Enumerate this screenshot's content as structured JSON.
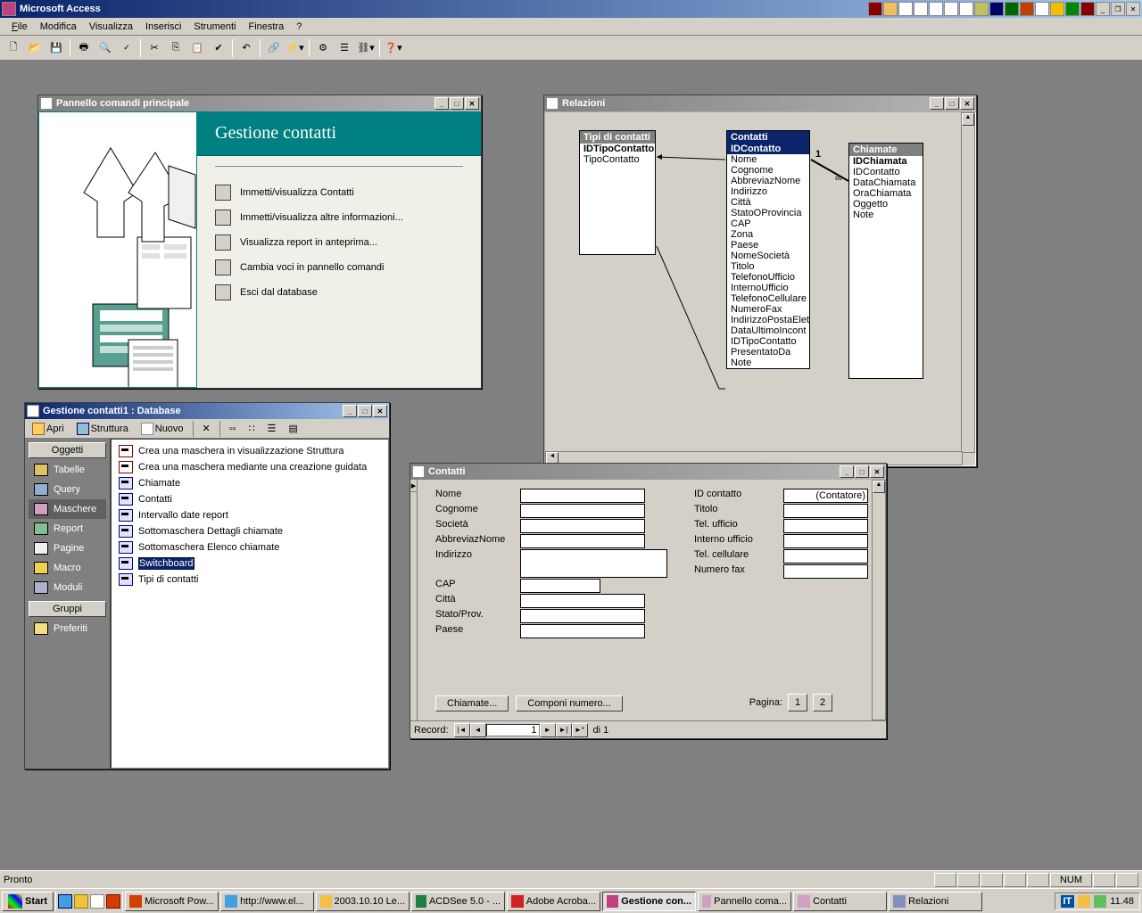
{
  "app": {
    "title": "Microsoft Access"
  },
  "menu": {
    "file": "File",
    "modifica": "Modifica",
    "visualizza": "Visualizza",
    "inserisci": "Inserisci",
    "strumenti": "Strumenti",
    "finestra": "Finestra",
    "help": "?"
  },
  "switchboard": {
    "title": "Pannello comandi principale",
    "heading": "Gestione contatti",
    "items": [
      "Immetti/visualizza Contatti",
      "Immetti/visualizza altre informazioni...",
      "Visualizza report in anteprima...",
      "Cambia voci in pannello comandi",
      "Esci dal database"
    ]
  },
  "dbwin": {
    "title": "Gestione contatti1 : Database",
    "toolbar": {
      "apri": "Apri",
      "struttura": "Struttura",
      "nuovo": "Nuovo"
    },
    "sidebar": {
      "header": "Oggetti",
      "tabelle": "Tabelle",
      "query": "Query",
      "maschere": "Maschere",
      "report": "Report",
      "pagine": "Pagine",
      "macro": "Macro",
      "moduli": "Moduli",
      "gruppi": "Gruppi",
      "preferiti": "Preferiti"
    },
    "list": [
      "Crea una maschera in visualizzazione Struttura",
      "Crea una maschera mediante una creazione guidata",
      "Chiamate",
      "Contatti",
      "Intervallo date report",
      "Sottomaschera Dettagli chiamate",
      "Sottomaschera Elenco chiamate",
      "Switchboard",
      "Tipi di contatti"
    ]
  },
  "relazioni": {
    "title": "Relazioni",
    "t1": {
      "name": "Tipi di contatti",
      "fields": [
        "IDTipoContatto",
        "TipoContatto"
      ]
    },
    "t2": {
      "name": "Contatti",
      "fields": [
        "IDContatto",
        "Nome",
        "Cognome",
        "AbbreviazNome",
        "Indirizzo",
        "Città",
        "StatoOProvincia",
        "CAP",
        "Zona",
        "Paese",
        "NomeSocietà",
        "Titolo",
        "TelefonoUfficio",
        "InternoUfficio",
        "TelefonoCellulare",
        "NumeroFax",
        "IndirizzoPostaElet",
        "DataUltimoIncont",
        "IDTipoContatto",
        "PresentatoDa",
        "Note"
      ]
    },
    "t3": {
      "name": "Chiamate",
      "fields": [
        "IDChiamata",
        "IDContatto",
        "DataChiamata",
        "OraChiamata",
        "Oggetto",
        "Note"
      ]
    },
    "rel_1": "1",
    "rel_inf": "∞"
  },
  "contatti": {
    "title": "Contatti",
    "labels": {
      "nome": "Nome",
      "cognome": "Cognome",
      "societa": "Società",
      "abbrev": "AbbreviazNome",
      "indirizzo": "Indirizzo",
      "cap": "CAP",
      "citta": "Città",
      "stato": "Stato/Prov.",
      "paese": "Paese",
      "idcontatto": "ID contatto",
      "titolo": "Titolo",
      "telufficio": "Tel. ufficio",
      "interno": "Interno ufficio",
      "telcell": "Tel. cellulare",
      "numfax": "Numero fax"
    },
    "idvalue": "(Contatore)",
    "buttons": {
      "chiamate": "Chiamate...",
      "componi": "Componi numero..."
    },
    "pagina": "Pagina:",
    "p1": "1",
    "p2": "2",
    "record": "Record:",
    "recval": "1",
    "reccount": "di 1"
  },
  "status": {
    "ready": "Pronto",
    "num": "NUM"
  },
  "taskbar": {
    "start": "Start",
    "tasks": [
      "Microsoft Pow...",
      "http://www.el...",
      "2003.10.10 Le...",
      "ACDSee 5.0 - ...",
      "Adobe Acroba...",
      "Gestione con...",
      "Pannello coma...",
      "Contatti",
      "Relazioni"
    ],
    "it": "IT",
    "time": "11.48"
  }
}
